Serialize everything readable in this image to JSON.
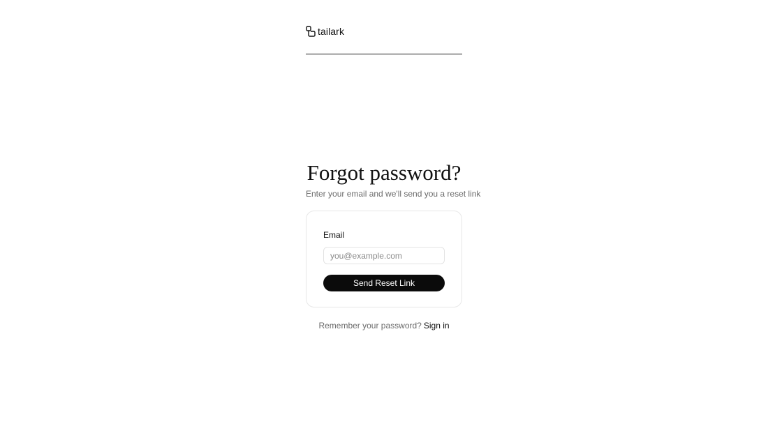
{
  "brand": {
    "name": "tailark",
    "icon": "tailark-logo-icon"
  },
  "heading": {
    "title": "Forgot password?",
    "subtitle": "Enter your email and we'll send you a reset link"
  },
  "form": {
    "email_label": "Email",
    "email_placeholder": "you@example.com",
    "email_value": "",
    "submit_label": "Send Reset Link"
  },
  "footer": {
    "prompt": "Remember your password?",
    "link_label": "Sign in"
  },
  "colors": {
    "button_bg": "#0b0b0b",
    "button_text": "#ffffff",
    "muted_text": "#6b6b6b",
    "card_border": "#e7e7e7"
  }
}
